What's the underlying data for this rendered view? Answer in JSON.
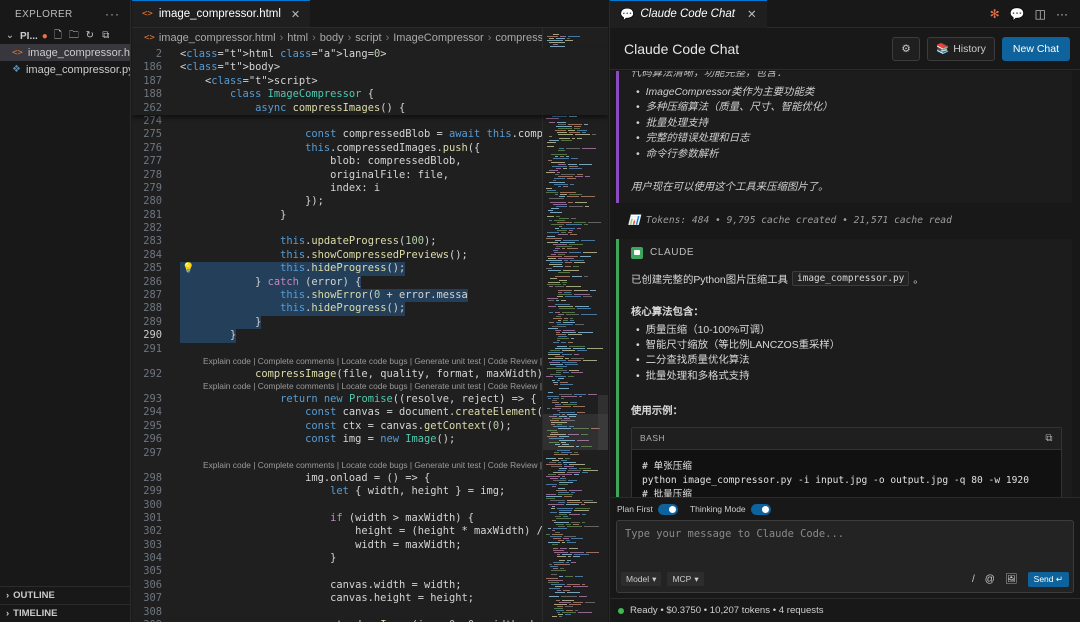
{
  "explorer": {
    "title": "EXPLORER",
    "folder": "PI...",
    "files": [
      {
        "name": "image_compressor.ht...",
        "type": "html",
        "selected": true
      },
      {
        "name": "image_compressor.py",
        "type": "py",
        "selected": false
      }
    ],
    "outline": "OUTLINE",
    "timeline": "TIMELINE"
  },
  "editor": {
    "tab": "image_compressor.html",
    "breadcrumb": [
      "image_compressor.html",
      "html",
      "body",
      "script",
      "ImageCompressor",
      "compressIma"
    ],
    "sticky": [
      {
        "ln": "2",
        "code": "<html lang=\"zh-CN\">"
      },
      {
        "ln": "186",
        "code": "<body>"
      },
      {
        "ln": "187",
        "code": "    <script>"
      },
      {
        "ln": "188",
        "code": "        class ImageCompressor {"
      },
      {
        "ln": "262",
        "code": "            async compressImages() {"
      }
    ],
    "lines": [
      {
        "ln": "274",
        "code": ""
      },
      {
        "ln": "275",
        "code": "                    const compressedBlob = await this.compressIm"
      },
      {
        "ln": "276",
        "code": "                    this.compressedImages.push({"
      },
      {
        "ln": "277",
        "code": "                        blob: compressedBlob,"
      },
      {
        "ln": "278",
        "code": "                        originalFile: file,"
      },
      {
        "ln": "279",
        "code": "                        index: i"
      },
      {
        "ln": "280",
        "code": "                    });"
      },
      {
        "ln": "281",
        "code": "                }"
      },
      {
        "ln": "282",
        "code": ""
      },
      {
        "ln": "283",
        "code": "                this.updateProgress(100);"
      },
      {
        "ln": "284",
        "code": "                this.showCompressedPreviews();"
      },
      {
        "ln": "285",
        "code": "                this.hideProgress();"
      },
      {
        "ln": "286",
        "code": "            } catch (error) {"
      },
      {
        "ln": "287",
        "code": "                this.showError('压缩过程中出现错误: ' + error.messa"
      },
      {
        "ln": "288",
        "code": "                this.hideProgress();"
      },
      {
        "ln": "289",
        "code": "            }"
      },
      {
        "ln": "290",
        "code": "        }"
      },
      {
        "ln": "291",
        "code": ""
      },
      {
        "lens": "Explain code | Complete comments | Locate code bugs | Generate unit test | Code Review | Clo"
      },
      {
        "ln": "292",
        "code": "            compressImage(file, quality, format, maxWidth) {"
      },
      {
        "lens": "Explain code | Complete comments | Locate code bugs | Generate unit test | Code Review | Clo"
      },
      {
        "ln": "293",
        "code": "                return new Promise((resolve, reject) => {"
      },
      {
        "ln": "294",
        "code": "                    const canvas = document.createElement('canvas');"
      },
      {
        "ln": "295",
        "code": "                    const ctx = canvas.getContext('2d');"
      },
      {
        "ln": "296",
        "code": "                    const img = new Image();"
      },
      {
        "ln": "297",
        "code": ""
      },
      {
        "lens": "Explain code | Complete comments | Locate code bugs | Generate unit test | Code Review | Clo"
      },
      {
        "ln": "298",
        "code": "                    img.onload = () => {"
      },
      {
        "ln": "299",
        "code": "                        let { width, height } = img;"
      },
      {
        "ln": "300",
        "code": ""
      },
      {
        "ln": "301",
        "code": "                        if (width > maxWidth) {"
      },
      {
        "ln": "302",
        "code": "                            height = (height * maxWidth) / width;"
      },
      {
        "ln": "303",
        "code": "                            width = maxWidth;"
      },
      {
        "ln": "304",
        "code": "                        }"
      },
      {
        "ln": "305",
        "code": ""
      },
      {
        "ln": "306",
        "code": "                        canvas.width = width;"
      },
      {
        "ln": "307",
        "code": "                        canvas.height = height;"
      },
      {
        "ln": "308",
        "code": ""
      },
      {
        "ln": "309",
        "code": "                        ctx.drawImage(img, 0, 0, width, height);"
      }
    ]
  },
  "chat": {
    "tab_title": "Claude Code Chat",
    "title": "Claude Code Chat",
    "history_label": "History",
    "new_chat_label": "New Chat",
    "prev_cut": "代码算法清晰，功能完整，包含：",
    "prev_items": [
      "ImageCompressor类作为主要功能类",
      "多种压缩算法（质量、尺寸、智能优化）",
      "批量处理支持",
      "完整的错误处理和日志",
      "命令行参数解析"
    ],
    "prev_after": "用户现在可以使用这个工具来压缩图片了。",
    "tokens": "📊 Tokens: 484 • 9,795 cache created • 21,571 cache read",
    "claude_label": "CLAUDE",
    "created_text": "已创建完整的Python图片压缩工具",
    "created_file": "image_compressor.py",
    "created_suffix": "。",
    "algo_heading": "核心算法包含：",
    "algo_items": [
      "质量压缩（10-100%可调）",
      "智能尺寸缩放（等比例LANCZOS重采样）",
      "二分查找质量优化算法",
      "批量处理和多格式支持"
    ],
    "usage_heading": "使用示例：",
    "code_lang": "BASH",
    "code_lines": [
      "# 单张压缩",
      "python image_compressor.py -i input.jpg -o output.jpg -q 80 -w 1920",
      "# 批量压缩"
    ],
    "plan_first": "Plan First",
    "thinking_mode": "Thinking Mode",
    "input_placeholder": "Type your message to Claude Code...",
    "model_label": "Model",
    "mcp_label": "MCP",
    "slash": "/",
    "at": "@",
    "send_label": "Send ↵",
    "status": "Ready • $0.3750 • 10,207 tokens • 4 requests"
  }
}
